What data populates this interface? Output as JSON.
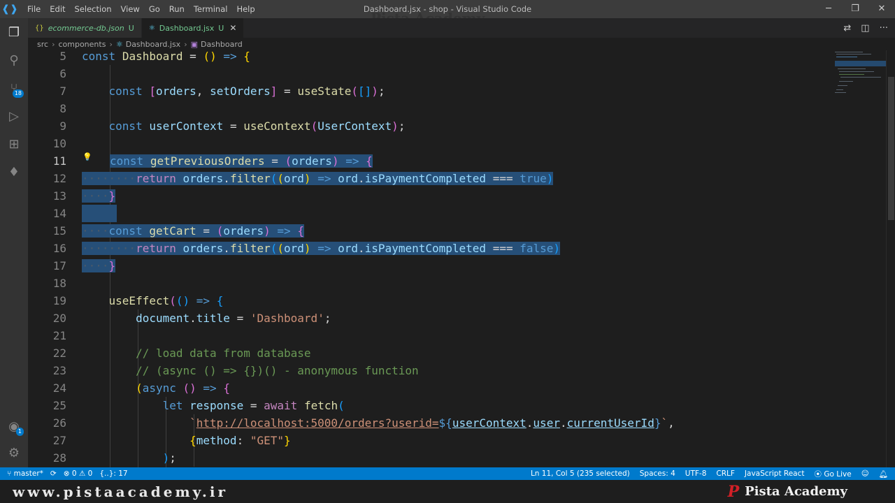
{
  "titlebar": {
    "menu": [
      "File",
      "Edit",
      "Selection",
      "View",
      "Go",
      "Run",
      "Terminal",
      "Help"
    ],
    "title": "Dashboard.jsx - shop - Visual Studio Code",
    "watermark": "Pista Academy"
  },
  "tabs": [
    {
      "icon": "{}",
      "label": "ecommerce-db.json",
      "status": "U"
    },
    {
      "icon": "⚛",
      "label": "Dashboard.jsx",
      "status": "U",
      "close": "✕"
    }
  ],
  "breadcrumb": [
    "src",
    "components",
    "Dashboard.jsx",
    "Dashboard"
  ],
  "activity_badges": {
    "source_control": "18",
    "accounts": "1"
  },
  "editor": {
    "line_numbers": [
      "5",
      "6",
      "7",
      "8",
      "9",
      "10",
      "11",
      "12",
      "13",
      "14",
      "15",
      "16",
      "17",
      "18",
      "19",
      "20",
      "21",
      "22",
      "23",
      "24",
      "25",
      "26",
      "27",
      "28"
    ],
    "code": {
      "l5": [
        "const",
        "Dashboard",
        "=",
        "()",
        "=>",
        "{"
      ],
      "l7": [
        "const",
        "[",
        "orders",
        ",",
        "setOrders",
        "]",
        "=",
        "useState",
        "(",
        "[]",
        ")",
        ";"
      ],
      "l9": [
        "const",
        "userContext",
        "=",
        "useContext",
        "(",
        "UserContext",
        ")",
        ";"
      ],
      "l11": [
        "const",
        "getPreviousOrders",
        "=",
        "(",
        "orders",
        ")",
        "=>",
        "{"
      ],
      "l12": [
        "return",
        "orders",
        ".",
        "filter",
        "(",
        "(",
        "ord",
        ")",
        "=>",
        "ord",
        ".",
        "isPaymentCompleted",
        "===",
        "true",
        ")"
      ],
      "l13": [
        "}"
      ],
      "l15": [
        "const",
        "getCart",
        "=",
        "(",
        "orders",
        ")",
        "=>",
        "{"
      ],
      "l16": [
        "return",
        "orders",
        ".",
        "filter",
        "(",
        "(",
        "ord",
        ")",
        "=>",
        "ord",
        ".",
        "isPaymentCompleted",
        "===",
        "false",
        ")"
      ],
      "l17": [
        "}"
      ],
      "l19": [
        "useEffect",
        "(",
        "()",
        "=>",
        "{"
      ],
      "l20": [
        "document",
        ".",
        "title",
        "=",
        "'Dashboard'",
        ";"
      ],
      "l22": [
        "// load data from database"
      ],
      "l23": [
        "// (async () => {})() - anonymous function"
      ],
      "l24": [
        "(",
        "async",
        "()",
        "=>",
        "{"
      ],
      "l25": [
        "let",
        "response",
        "=",
        "await",
        "fetch",
        "("
      ],
      "l26": [
        "`",
        "http://localhost:5000/orders?userid=",
        "${",
        "userContext",
        ".",
        "user",
        ".",
        "currentUserId",
        "}",
        "`",
        ","
      ],
      "l27": [
        "{",
        "method",
        ":",
        "\"GET\"",
        "}"
      ],
      "l28": [
        ")",
        ";"
      ]
    }
  },
  "statusbar": {
    "branch": "master*",
    "errors": "0",
    "warnings": "0",
    "brackets": "{..}: 17",
    "cursor": "Ln 11, Col 5 (235 selected)",
    "spaces": "Spaces: 4",
    "encoding": "UTF-8",
    "eol": "CRLF",
    "language": "JavaScript React",
    "golive": "Go Live"
  },
  "footer": {
    "site": "www.pistaacademy.ir",
    "brand_mark": "P",
    "brand": "Pista Academy"
  }
}
